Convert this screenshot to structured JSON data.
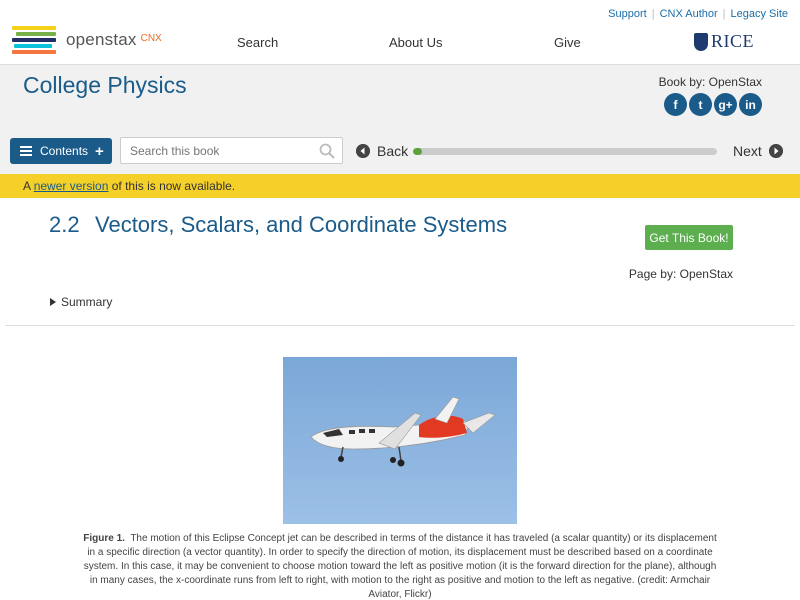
{
  "utility": {
    "support": "Support",
    "cnx_author": "CNX Author",
    "legacy_site": "Legacy Site"
  },
  "logo": {
    "wordmark": "openstax",
    "cnx": "CNX"
  },
  "nav": {
    "search": "Search",
    "about": "About Us",
    "give": "Give",
    "rice": "RICE"
  },
  "book": {
    "title": "College Physics",
    "by": "Book by: OpenStax"
  },
  "social": {
    "facebook": "f",
    "twitter": "t",
    "google": "g+",
    "linkedin": "in"
  },
  "toolbar": {
    "contents": "Contents",
    "search_placeholder": "Search this book",
    "back": "Back",
    "next": "Next",
    "progress_fraction": 0.03
  },
  "notice": {
    "prefix": "A ",
    "link": "newer version",
    "suffix": " of this is now available."
  },
  "section": {
    "number": "2.2",
    "title": "Vectors, Scalars, and Coordinate Systems",
    "get_book": "Get This Book!",
    "page_by": "Page by: OpenStax",
    "summary": "Summary"
  },
  "figure": {
    "label": "Figure 1.",
    "caption": "The motion of this Eclipse Concept jet can be described in terms of the distance it has traveled (a scalar quantity) or its displacement in a specific direction (a vector quantity). In order to specify the direction of motion, its displacement must be described based on a coordinate system. In this case, it may be convenient to choose motion toward the left as positive motion (it is the forward direction for the plane), although in many cases, the x-coordinate runs from left to right, with motion to the right as positive and motion to the left as negative. (credit: Armchair Aviator, Flickr)"
  },
  "colors": {
    "brand_blue": "#1a5b8a",
    "notice_yellow": "#f5d029",
    "green": "#5cae4f"
  }
}
